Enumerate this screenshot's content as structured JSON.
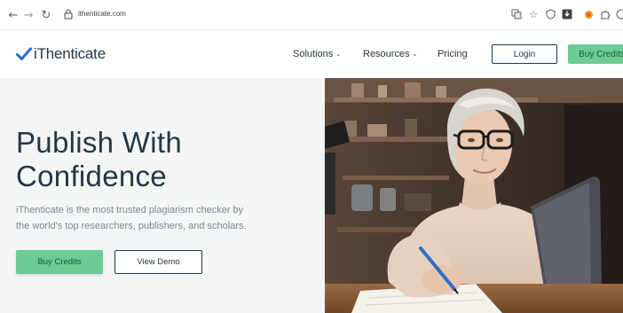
{
  "browser": {
    "url": "ithenticate.com",
    "icons": [
      "back-icon",
      "forward-icon",
      "reload-icon",
      "lock-icon",
      "translate-icon",
      "star-icon",
      "shield-icon",
      "download-icon",
      "extension-orange-icon",
      "puzzle-icon",
      "profile-icon"
    ]
  },
  "header": {
    "logo_text": "iThenticate",
    "nav": {
      "solutions": "Solutions",
      "resources": "Resources",
      "pricing": "Pricing"
    },
    "login_label": "Login",
    "buy_label": "Buy Credits"
  },
  "hero": {
    "title_line1": "Publish With",
    "title_line2": "Confidence",
    "subtitle_line1": "iThenticate is the most trusted plagiarism checker by",
    "subtitle_line2": "the world's top researchers, publishers, and scholars.",
    "buy_label": "Buy Credits",
    "demo_label": "View Demo"
  },
  "colors": {
    "brand_navy": "#243746",
    "brand_blue_check": "#2b6bd6",
    "accent_green": "#6ccc94",
    "hero_bg": "#f4f6f6"
  }
}
